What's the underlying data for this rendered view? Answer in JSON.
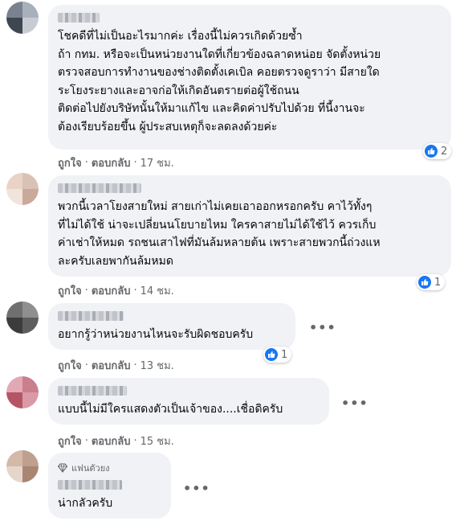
{
  "comments": [
    {
      "text": "โชคดีที่ไม่เป็นอะไรมากค่ะ เรื่องนี้ไม่ควรเกิดด้วยซ้ำ\nถ้า กทม. หรือจะเป็นหน่วยงานใดที่เกี่ยวข้องฉลาดหน่อย จัดตั้งหน่วย\nตรวจสอบการทำงานของช่างติดตั้งเคเบิล คอยตรวจดูราว่า มีสายใด\nระโยงระยางและอาจก่อให้เกิดอันตรายต่อผู้ใช้ถนน\nติดต่อไปยังบริษัทนั้นให้มาแก้ไข และคิดค่าปรับไปด้วย ที่นี้งานจะ\nต้องเรียบร้อยขึ้น ผู้ประสบเหตุก็จะลดลงด้วยค่ะ",
      "like": "ถูกใจ",
      "reply": "ตอบกลับ",
      "time": "17 ชม.",
      "reactions": "2"
    },
    {
      "text": "พวกนี้เวลาโยงสายใหม่ สายเก่าไม่เคยเอาออกหรอกครับ คาไว้ทั้งๆ\nที่ไม่ได้ใช้ น่าจะเปลี่ยนนโยบายไหม ใครคาสายไม่ได้ใช้ไว้ ควรเก็บ\nค่าเช่าให้หมด รถชนเสาไฟที่มันล้มหลายต้น เพราะสายพวกนี้ถ่วงแห\nละครับเลยพากันล้มหมด",
      "like": "ถูกใจ",
      "reply": "ตอบกลับ",
      "time": "14 ชม.",
      "reactions": "1"
    },
    {
      "text": "อยากรู้ว่าหน่วยงานไหนจะรับผิดชอบครับ",
      "like": "ถูกใจ",
      "reply": "ตอบกลับ",
      "time": "13 ชม.",
      "reactions": "1"
    },
    {
      "text": "แบบนี้ไม่มีใครแสดงตัวเป็นเจ้าของ....เชื่อดิครับ",
      "like": "ถูกใจ",
      "reply": "ตอบกลับ",
      "time": "15 ชม."
    },
    {
      "badge": "แฟนตัวยง",
      "text": "น่ากลัวครับ"
    }
  ],
  "more_options": "•••",
  "colors": {
    "bubble": "#f0f2f5",
    "like_blue": "#1877f2",
    "meta_gray": "#65676b"
  }
}
